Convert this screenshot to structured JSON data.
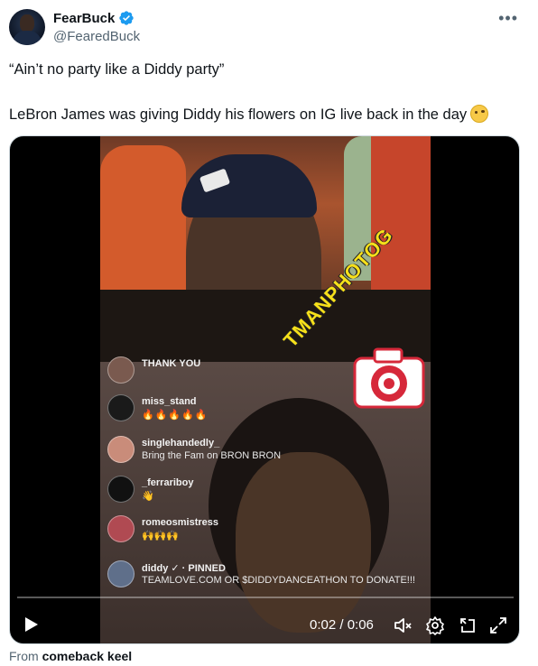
{
  "tweet": {
    "display_name": "FearBuck",
    "handle": "@FearedBuck",
    "line1": "“Ain’t no party like a Diddy party”",
    "line2": "LeBron James was giving Diddy his flowers on IG live back in the day",
    "emoji_icon": "face-with-raised-eyebrow-icon"
  },
  "video": {
    "comments": [
      {
        "user": "THANK YOU",
        "text": ""
      },
      {
        "user": "miss_stand",
        "text": "🔥🔥🔥🔥🔥"
      },
      {
        "user": "singlehandedly_",
        "text": "Bring the Fam on BRON BRON"
      },
      {
        "user": "_ferrariboy",
        "text": "👋"
      },
      {
        "user": "romeosmistress",
        "text": "🙌🙌🙌"
      },
      {
        "user": "diddy ✓ · PINNED",
        "text": "TEAMLOVE.COM OR $DIDDYDANCEATHON TO DONATE!!!"
      }
    ],
    "watermark": "TMANPHOTOG",
    "time_display": "0:02 / 0:06",
    "progress": 0.0,
    "colors": {
      "watermark": "#f6e01a",
      "verified": "#1d9bf0"
    }
  },
  "footer": {
    "source_prefix": "From",
    "source_name": "comeback keel"
  }
}
